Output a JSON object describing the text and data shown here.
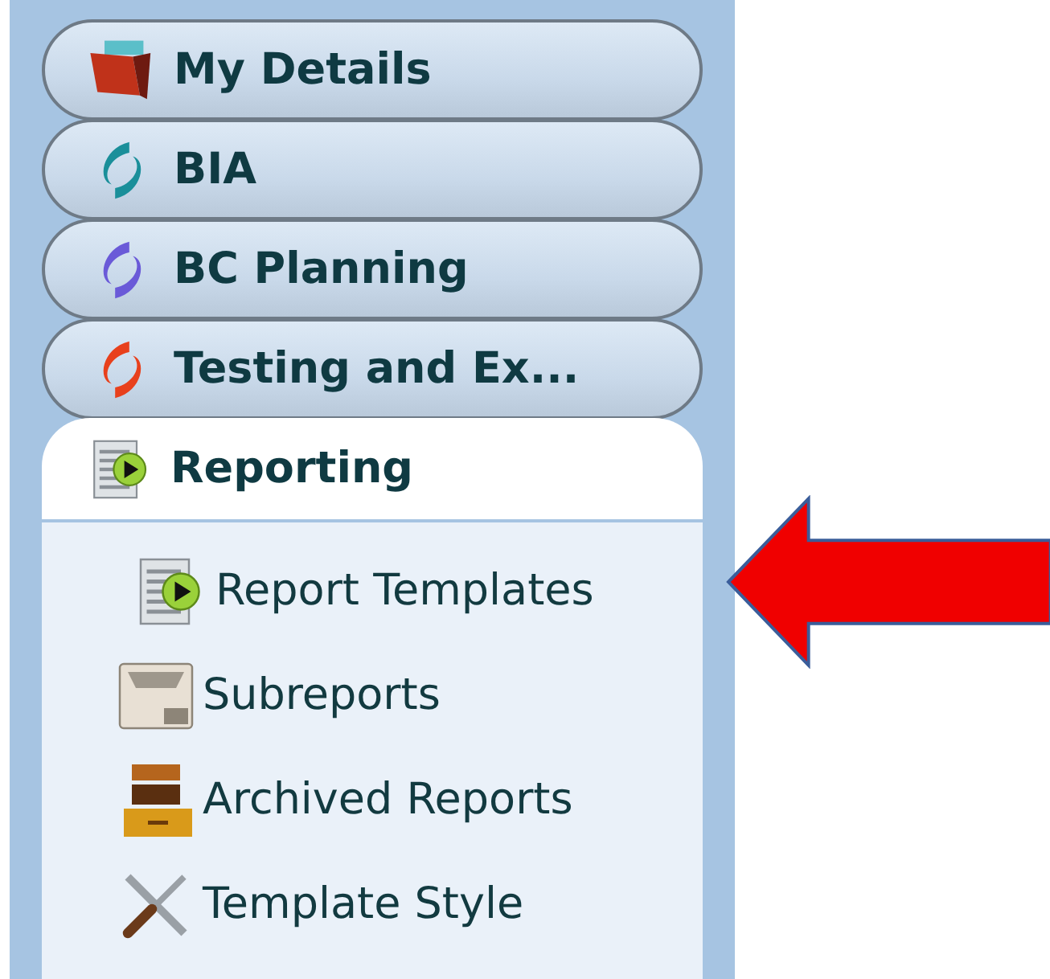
{
  "menu": [
    {
      "label": "My Details",
      "kind": "folder",
      "expanded": false
    },
    {
      "label": "BIA",
      "kind": "swirl",
      "color": "#1a8f9a",
      "expanded": false
    },
    {
      "label": "BC Planning",
      "kind": "swirl",
      "color": "#6a5ad8",
      "expanded": false
    },
    {
      "label": "Testing and Ex...",
      "kind": "swirl",
      "color": "#e8401c",
      "expanded": false
    },
    {
      "label": "Reporting",
      "kind": "report",
      "expanded": true,
      "children": [
        {
          "label": "Report Templates",
          "kind": "report"
        },
        {
          "label": "Subreports",
          "kind": "tray"
        },
        {
          "label": "Archived Reports",
          "kind": "drawers"
        },
        {
          "label": "Template Style",
          "kind": "tools"
        }
      ]
    }
  ]
}
